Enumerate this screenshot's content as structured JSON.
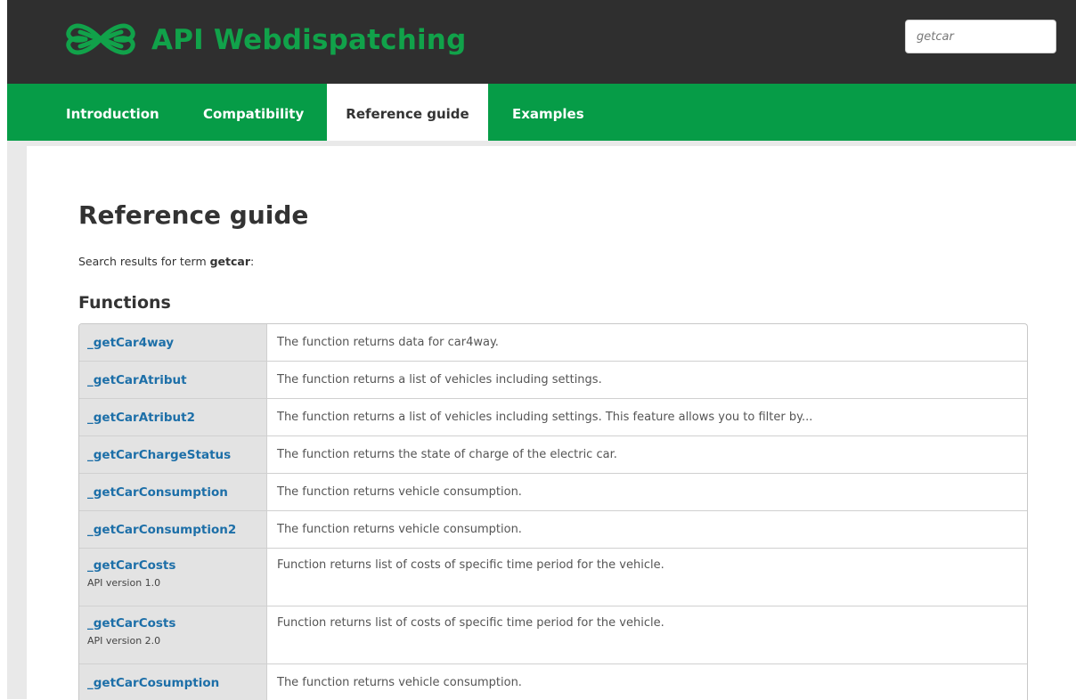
{
  "app": {
    "title": "API Webdispatching",
    "logo_icon": "clover-logo-icon",
    "brand_color": "#11a24a"
  },
  "search": {
    "value": "getcar"
  },
  "nav": {
    "tabs": [
      {
        "label": "Introduction",
        "active": false
      },
      {
        "label": "Compatibility",
        "active": false
      },
      {
        "label": "Reference guide",
        "active": true
      },
      {
        "label": "Examples",
        "active": false
      }
    ],
    "bar_color": "#069c47"
  },
  "main": {
    "title": "Reference guide",
    "search_prefix": "Search results for term",
    "search_term": "getcar",
    "search_suffix": ":",
    "section_title": "Functions"
  },
  "functions": [
    {
      "name": "_getCar4way",
      "version": "",
      "description": "The function returns data for car4way."
    },
    {
      "name": "_getCarAtribut",
      "version": "",
      "description": "The function returns a list of vehicles including settings."
    },
    {
      "name": "_getCarAtribut2",
      "version": "",
      "description": "The function returns a list of vehicles including settings. This feature allows you to filter by..."
    },
    {
      "name": "_getCarChargeStatus",
      "version": "",
      "description": "The function returns the state of charge of the electric car."
    },
    {
      "name": "_getCarConsumption",
      "version": "",
      "description": "The function returns vehicle consumption."
    },
    {
      "name": "_getCarConsumption2",
      "version": "",
      "description": "The function returns vehicle consumption."
    },
    {
      "name": "_getCarCosts",
      "version": "API version 1.0",
      "description": "Function returns list of costs of specific time period for the vehicle."
    },
    {
      "name": "_getCarCosts",
      "version": "API version 2.0",
      "description": "Function returns list of costs of specific time period for the vehicle."
    },
    {
      "name": "_getCarCosumption",
      "version": "",
      "description": "The function returns vehicle consumption."
    }
  ]
}
